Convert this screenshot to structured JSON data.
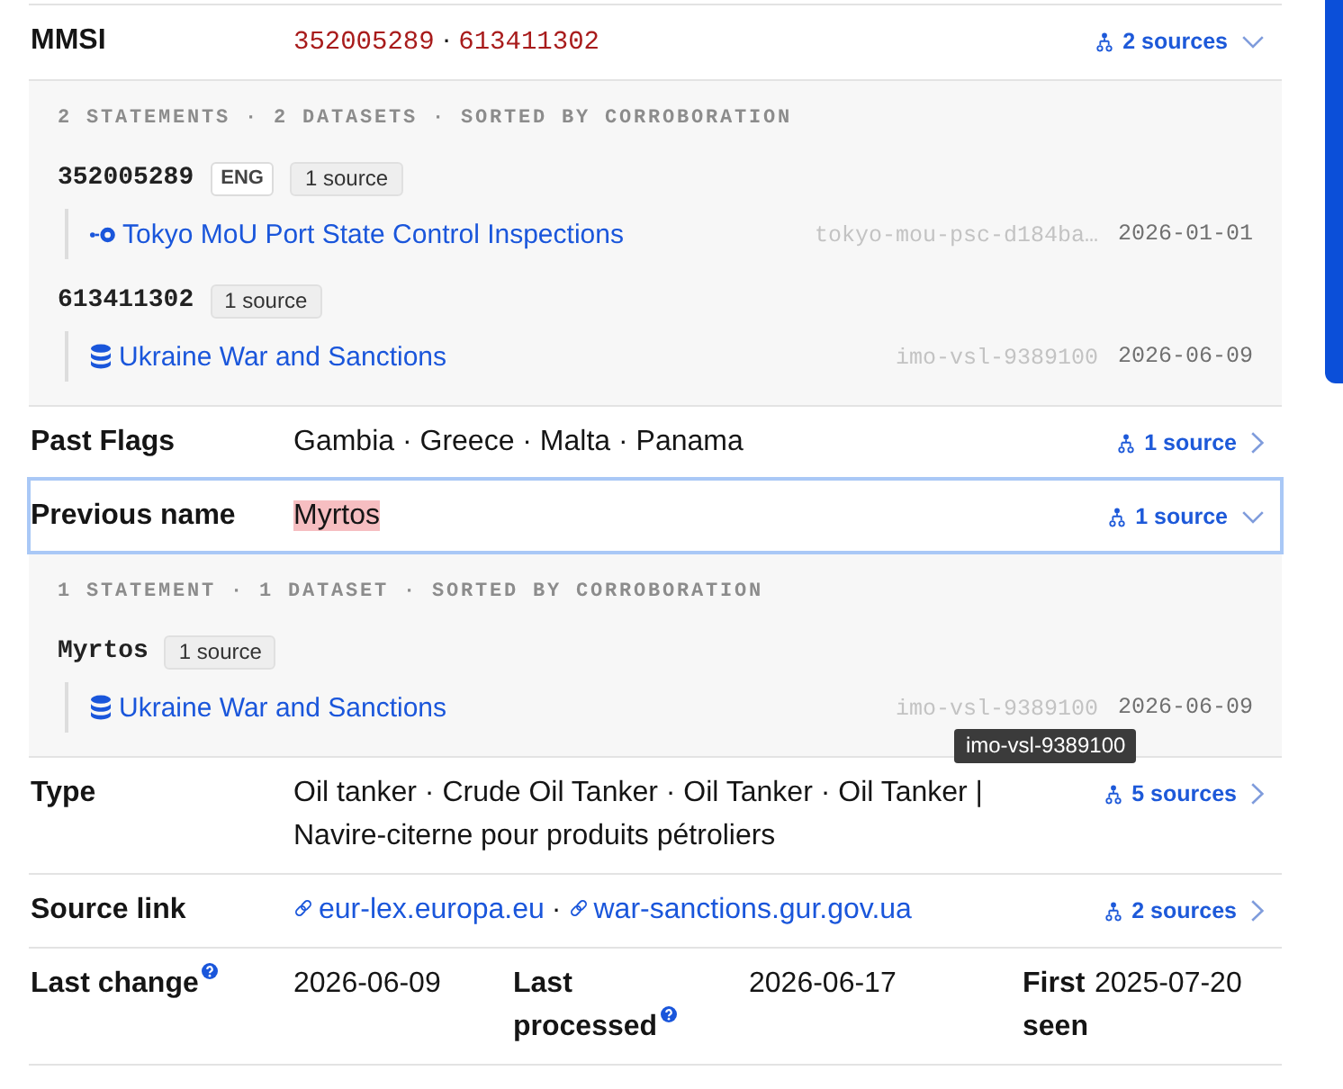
{
  "rows": [
    {
      "kind": "codes",
      "label": "MMSI",
      "values": [
        "352005289",
        "613411302"
      ],
      "separator": "·",
      "highlighted": false,
      "selected": false,
      "expanded": true,
      "sources": "2 sources",
      "panel": {
        "summary": "2 STATEMENTS · 2 DATASETS · SORTED BY CORROBORATION",
        "statements": [
          {
            "value": "352005289",
            "tags": [
              "ENG"
            ],
            "count": "1 source",
            "sources": [
              {
                "kind": "feed",
                "name": "Tokyo MoU Port State Control Inspections",
                "id": "tokyo-mou-psc-d184ba…",
                "date": "2026-01-01"
              }
            ]
          },
          {
            "value": "613411302",
            "count": "1 source",
            "sources": [
              {
                "kind": "dataset",
                "name": "Ukraine War and Sanctions",
                "id": "imo-vsl-9389100",
                "date": "2026-06-09"
              }
            ]
          }
        ]
      }
    },
    {
      "kind": "text",
      "label": "Past Flags",
      "value": "Gambia · Greece · Malta · Panama",
      "highlighted": false,
      "selected": false,
      "expanded": false,
      "sources": "1 source"
    },
    {
      "kind": "text",
      "label": "Previous name",
      "value": "Myrtos",
      "highlighted": true,
      "selected": true,
      "expanded": true,
      "sources": "1 source",
      "panel": {
        "summary": "1 STATEMENT · 1 DATASET · SORTED BY CORROBORATION",
        "statements": [
          {
            "value": "Myrtos",
            "count": "1 source",
            "sources": [
              {
                "kind": "dataset",
                "name": "Ukraine War and Sanctions",
                "id": "imo-vsl-9389100",
                "date": "2026-06-09",
                "tooltip": "imo-vsl-9389100"
              }
            ]
          }
        ]
      }
    },
    {
      "kind": "text",
      "label": "Type",
      "value": "Oil tanker · Crude Oil Tanker · Oil Tanker · Oil Tanker | Navire-citerne pour produits pétroliers",
      "highlighted": false,
      "selected": false,
      "expanded": false,
      "sources": "5 sources"
    },
    {
      "kind": "links",
      "label": "Source link",
      "values": [
        "eur-lex.europa.eu",
        "war-sanctions.gur.gov.ua"
      ],
      "separator": "·",
      "highlighted": false,
      "selected": false,
      "expanded": false,
      "sources": "2 sources"
    },
    {
      "kind": "dates",
      "pairs": [
        {
          "label": "Last change",
          "help": true,
          "value": "2026-06-09"
        },
        {
          "label": "Last processed",
          "help": true,
          "value": "2026-06-17"
        },
        {
          "label": "First seen",
          "help": false,
          "value": "2025-07-20"
        }
      ],
      "highlighted": false,
      "selected": false
    }
  ]
}
